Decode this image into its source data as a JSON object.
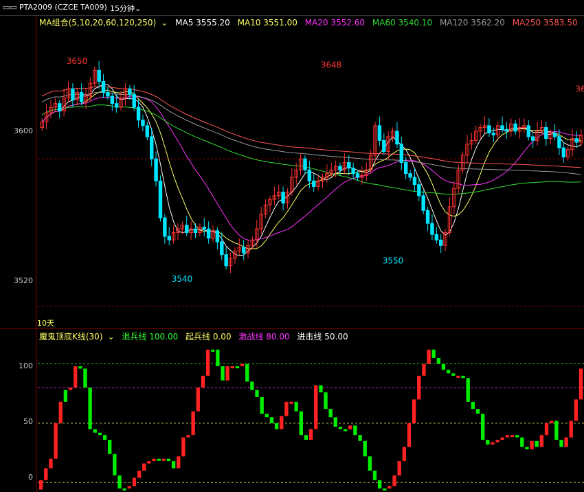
{
  "header": {
    "symbol": "PTA2009 (CZCE TA009)",
    "period": "15分钟"
  },
  "ma_legend": {
    "group": "MA组合(5,10,20,60,120,250)",
    "items": [
      {
        "label": "MA5 3555.20",
        "color": "#ffffff"
      },
      {
        "label": "MA10 3551.00",
        "color": "#ffff66"
      },
      {
        "label": "MA20 3552.60",
        "color": "#ff33ff"
      },
      {
        "label": "MA60 3540.10",
        "color": "#33dd33"
      },
      {
        "label": "MA120 3562.20",
        "color": "#999999"
      },
      {
        "label": "MA250 3583.50",
        "color": "#ff5555"
      }
    ]
  },
  "sub_legend": {
    "name": "魔鬼顶底K线(30)",
    "items": [
      {
        "label": "退兵线 100.00",
        "color": "#33ff33"
      },
      {
        "label": "起兵线 0.00",
        "color": "#ffff66"
      },
      {
        "label": "激战线 80.00",
        "color": "#ff33ff"
      },
      {
        "label": "进击线 50.00",
        "color": "#ffffff"
      }
    ]
  },
  "period_label": "10天",
  "colors": {
    "up": "#ff3333",
    "down": "#00e5ff",
    "sub_up": "#ff2222",
    "sub_down": "#00ee00",
    "grid": "#8b0000"
  },
  "chart_data": [
    {
      "type": "candlestick",
      "ylim": [
        3508,
        3672
      ],
      "y_ticks": [
        3600,
        3520
      ],
      "annotations": [
        {
          "text": "3650",
          "value": 3650
        },
        {
          "text": "3648",
          "value": 3648
        },
        {
          "text": "3540",
          "value": 3540
        },
        {
          "text": "3550",
          "value": 3550
        },
        {
          "text": "36",
          "value": 3635
        }
      ],
      "close": [
        3620,
        3625,
        3628,
        3630,
        3626,
        3633,
        3638,
        3632,
        3636,
        3631,
        3634,
        3641,
        3648,
        3642,
        3636,
        3634,
        3630,
        3628,
        3633,
        3638,
        3635,
        3628,
        3621,
        3618,
        3612,
        3600,
        3588,
        3568,
        3558,
        3556,
        3560,
        3562,
        3564,
        3560,
        3562,
        3560,
        3563,
        3562,
        3557,
        3561,
        3555,
        3548,
        3542,
        3546,
        3550,
        3552,
        3549,
        3553,
        3556,
        3562,
        3570,
        3575,
        3578,
        3580,
        3582,
        3576,
        3582,
        3590,
        3594,
        3600,
        3594,
        3588,
        3585,
        3588,
        3590,
        3592,
        3594,
        3596,
        3594,
        3598,
        3595,
        3592,
        3590,
        3591,
        3594,
        3602,
        3618,
        3610,
        3604,
        3612,
        3615,
        3608,
        3598,
        3592,
        3590,
        3586,
        3580,
        3572,
        3565,
        3559,
        3556,
        3553,
        3560,
        3574,
        3584,
        3594,
        3602,
        3608,
        3610,
        3615,
        3617,
        3618,
        3614,
        3613,
        3618,
        3616,
        3615,
        3619,
        3615,
        3617,
        3618,
        3612,
        3610,
        3615,
        3617,
        3611,
        3614,
        3612,
        3606,
        3601,
        3605,
        3611,
        3609,
        3613
      ],
      "ma_series": [
        "MA5",
        "MA10",
        "MA20",
        "MA60",
        "MA120",
        "MA250"
      ]
    },
    {
      "type": "bar-oscillator",
      "name": "魔鬼顶底K线(30)",
      "ylim": [
        -8,
        120
      ],
      "y_ticks": [
        100,
        50,
        0
      ],
      "levels": [
        {
          "value": 100,
          "color": "#33ff33"
        },
        {
          "value": 80,
          "color": "#ff33ff"
        },
        {
          "value": 50,
          "color": "#ffff66"
        },
        {
          "value": 0,
          "color": "#ffff66"
        }
      ],
      "values": [
        2,
        12,
        20,
        50,
        68,
        78,
        80,
        98,
        96,
        80,
        45,
        42,
        40,
        36,
        24,
        6,
        -5,
        -5,
        -3,
        4,
        10,
        16,
        18,
        20,
        20,
        20,
        18,
        12,
        22,
        38,
        40,
        60,
        80,
        90,
        112,
        112,
        98,
        86,
        98,
        98,
        98,
        100,
        85,
        78,
        72,
        58,
        55,
        50,
        45,
        56,
        68,
        68,
        60,
        40,
        36,
        45,
        82,
        76,
        62,
        55,
        47,
        45,
        45,
        48,
        40,
        35,
        22,
        10,
        2,
        -5,
        -5,
        -3,
        6,
        18,
        30,
        50,
        70,
        90,
        100,
        112,
        105,
        100,
        95,
        92,
        90,
        90,
        88,
        68,
        62,
        58,
        36,
        32,
        34,
        36,
        38,
        40,
        40,
        38,
        30,
        28,
        35,
        30,
        40,
        50,
        52,
        36,
        30,
        38,
        52,
        70,
        96
      ],
      "ups": [
        1,
        1,
        1,
        1,
        1,
        0,
        1,
        1,
        0,
        0,
        0,
        0,
        0,
        0,
        0,
        0,
        0,
        0,
        1,
        1,
        1,
        1,
        1,
        1,
        0,
        1,
        0,
        0,
        1,
        1,
        1,
        1,
        1,
        1,
        1,
        0,
        0,
        0,
        1,
        1,
        0,
        1,
        0,
        0,
        0,
        0,
        0,
        0,
        0,
        1,
        1,
        1,
        0,
        0,
        0,
        1,
        1,
        0,
        0,
        0,
        0,
        0,
        0,
        1,
        0,
        0,
        0,
        0,
        0,
        0,
        0,
        1,
        1,
        1,
        1,
        1,
        1,
        1,
        1,
        1,
        0,
        0,
        0,
        0,
        0,
        1,
        0,
        0,
        0,
        0,
        0,
        0,
        1,
        1,
        1,
        1,
        1,
        0,
        0,
        0,
        1,
        0,
        1,
        1,
        1,
        0,
        0,
        1,
        1,
        1,
        1,
        1
      ]
    }
  ]
}
